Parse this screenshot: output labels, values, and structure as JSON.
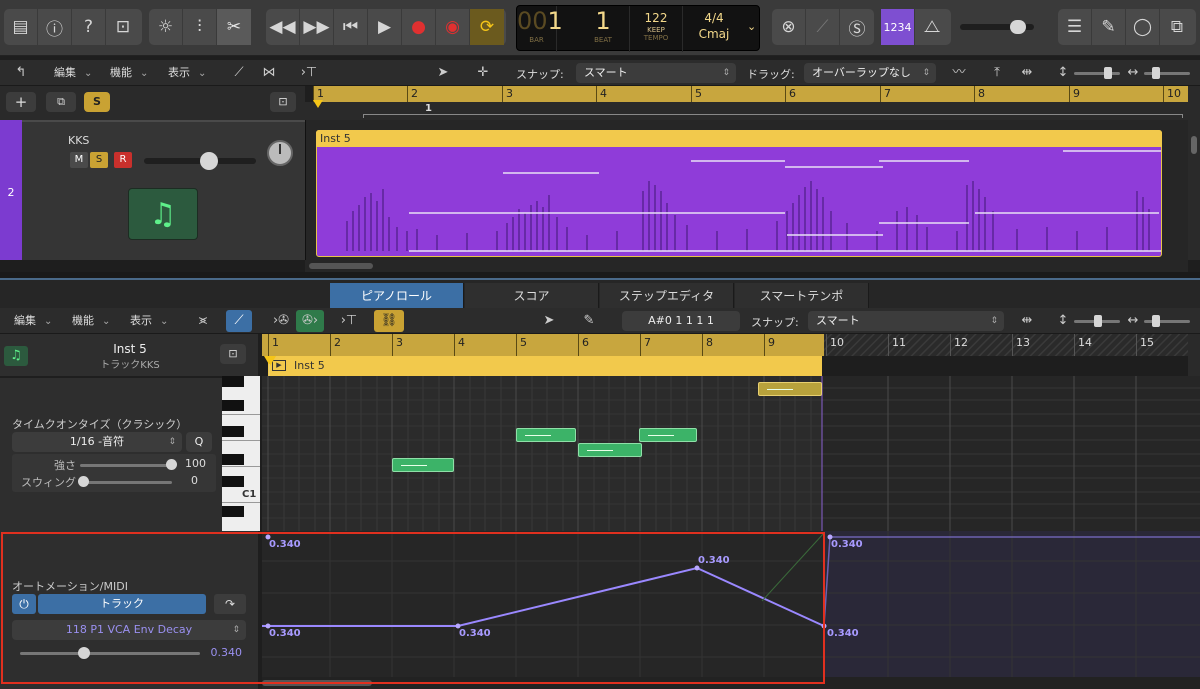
{
  "lcd": {
    "bar": "1",
    "bar_prefix": "00",
    "beat": "1",
    "bar_label": "BAR",
    "beat_label": "BEAT",
    "tempo": "122",
    "keep": "KEEP",
    "tempo_label": "TEMPO",
    "signature": "4/4",
    "key": "Cmaj"
  },
  "top": {
    "count_in": "1234"
  },
  "track_toolbar": {
    "edit": "編集",
    "functions": "機能",
    "view": "表示",
    "snap_label": "スナップ:",
    "snap_value": "スマート",
    "drag_label": "ドラッグ:",
    "drag_value": "オーバーラップなし"
  },
  "track_header": {
    "add": "+",
    "s": "S"
  },
  "track": {
    "number": "2",
    "name": "KKS",
    "mute": "M",
    "solo": "S",
    "record": "R"
  },
  "ruler_bars": [
    "1",
    "2",
    "3",
    "4",
    "5",
    "6",
    "7",
    "8",
    "9",
    "10"
  ],
  "ruler_sub": "1",
  "region": {
    "name": "Inst 5"
  },
  "tabs": [
    {
      "label": "ピアノロール",
      "active": true
    },
    {
      "label": "スコア",
      "active": false
    },
    {
      "label": "ステップエディタ",
      "active": false
    },
    {
      "label": "スマートテンポ",
      "active": false
    }
  ],
  "pr_toolbar": {
    "edit": "編集",
    "functions": "機能",
    "view": "表示",
    "position": "A#0  1 1 1 1",
    "snap_label": "スナップ:",
    "snap_value": "スマート"
  },
  "inspector": {
    "region_name": "Inst 5",
    "track_name": "トラックKKS",
    "quantize_title": "タイムクオンタイズ（クラシック）",
    "quantize_value": "1/16 -音符",
    "q": "Q",
    "strength_label": "強さ",
    "strength_value": "100",
    "swing_label": "スウィング",
    "swing_value": "0",
    "automation_title": "オートメーション/MIDI",
    "mode": "トラック",
    "parameter": "118 P1 VCA Env Decay",
    "param_value": "0.340"
  },
  "pr_ruler_bars": [
    "1",
    "2",
    "3",
    "4",
    "5",
    "6",
    "7",
    "8",
    "9",
    "10",
    "11",
    "12",
    "13",
    "14",
    "15"
  ],
  "pr_region": "Inst 5",
  "key_label": "C1",
  "automation_points": [
    "0.340",
    "0.340",
    "0.340",
    "0.340",
    "0.340",
    "0.340"
  ]
}
